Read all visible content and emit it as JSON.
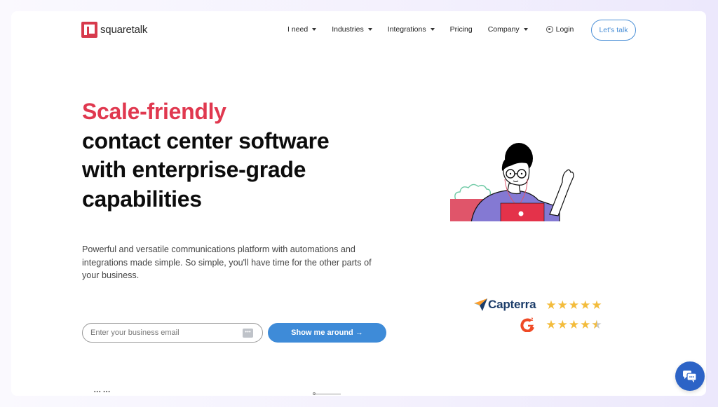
{
  "brand": {
    "name": "squaretalk",
    "accent_color": "#e0384f",
    "primary_color": "#3e8bd8"
  },
  "nav": {
    "items": [
      {
        "label": "I need",
        "dropdown": true
      },
      {
        "label": "Industries",
        "dropdown": true
      },
      {
        "label": "Integrations",
        "dropdown": true
      },
      {
        "label": "Pricing",
        "dropdown": false
      },
      {
        "label": "Company",
        "dropdown": true
      }
    ],
    "login_label": "Login",
    "lets_talk_label": "Let's talk"
  },
  "hero": {
    "title_accent": "Scale-friendly",
    "title_lines": [
      "contact center software",
      "with enterprise-grade",
      "capabilities"
    ],
    "description": "Powerful and versatile communications platform with automations and integrations made simple. So simple, you'll have time for the other parts of your business.",
    "email_placeholder": "Enter your business email",
    "email_value": "",
    "cta_label": "Show me around →"
  },
  "ratings": [
    {
      "brand": "Capterra",
      "icon": "capterra-logo",
      "stars": 5,
      "max": 5
    },
    {
      "brand": "G2",
      "icon": "g2-logo",
      "stars": 4.5,
      "max": 5
    }
  ],
  "chat": {
    "icon": "chat-bubbles-icon"
  }
}
